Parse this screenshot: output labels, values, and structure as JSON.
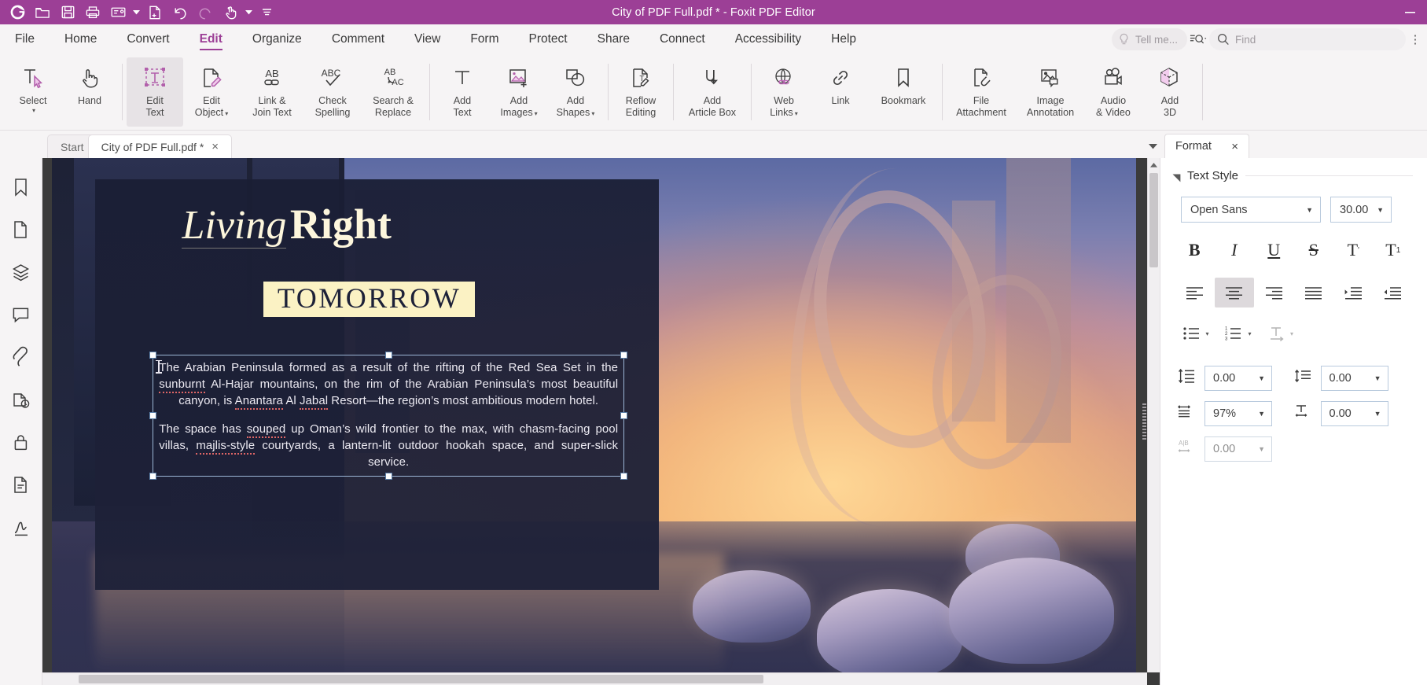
{
  "titlebar": {
    "title": "City of PDF Full.pdf * - Foxit PDF Editor",
    "quick_access": [
      {
        "name": "foxit-logo-icon",
        "label": "Foxit"
      },
      {
        "name": "open-folder-icon",
        "label": "Open"
      },
      {
        "name": "save-icon",
        "label": "Save"
      },
      {
        "name": "print-icon",
        "label": "Print"
      },
      {
        "name": "email-icon",
        "label": "Email"
      },
      {
        "name": "new-document-icon",
        "label": "Create"
      },
      {
        "name": "undo-icon",
        "label": "Undo"
      },
      {
        "name": "redo-icon",
        "label": "Redo"
      },
      {
        "name": "touch-mode-icon",
        "label": "Touch Mode"
      }
    ],
    "minimize_label": "Minimize"
  },
  "ribbon_tabs": [
    {
      "label": "File",
      "active": false
    },
    {
      "label": "Home",
      "active": false
    },
    {
      "label": "Convert",
      "active": false
    },
    {
      "label": "Edit",
      "active": true
    },
    {
      "label": "Organize",
      "active": false
    },
    {
      "label": "Comment",
      "active": false
    },
    {
      "label": "View",
      "active": false
    },
    {
      "label": "Form",
      "active": false
    },
    {
      "label": "Protect",
      "active": false
    },
    {
      "label": "Share",
      "active": false
    },
    {
      "label": "Connect",
      "active": false
    },
    {
      "label": "Accessibility",
      "active": false
    },
    {
      "label": "Help",
      "active": false
    }
  ],
  "tabbar_right": {
    "tell_me_placeholder": "Tell me...",
    "find_placeholder": "Find",
    "advanced_search_label": "Advanced Search",
    "more_label": "More"
  },
  "ribbon_groups": [
    {
      "items": [
        {
          "label_line1": "Select",
          "label_line2": "",
          "icon": "select-tool-icon",
          "caret": true,
          "active": false
        },
        {
          "label_line1": "Hand",
          "label_line2": "",
          "icon": "hand-tool-icon",
          "caret": false,
          "active": false
        }
      ]
    },
    {
      "items": [
        {
          "label_line1": "Edit",
          "label_line2": "Text",
          "icon": "edit-text-icon",
          "caret": false,
          "active": true
        },
        {
          "label_line1": "Edit",
          "label_line2": "Object",
          "icon": "edit-object-icon",
          "caret": true,
          "active": false
        },
        {
          "label_line1": "Link &",
          "label_line2": "Join Text",
          "icon": "link-join-text-icon",
          "caret": false,
          "active": false
        },
        {
          "label_line1": "Check",
          "label_line2": "Spelling",
          "icon": "check-spelling-icon",
          "caret": false,
          "active": false
        },
        {
          "label_line1": "Search &",
          "label_line2": "Replace",
          "icon": "search-replace-icon",
          "caret": false,
          "active": false
        }
      ]
    },
    {
      "items": [
        {
          "label_line1": "Add",
          "label_line2": "Text",
          "icon": "add-text-icon",
          "caret": false,
          "active": false
        },
        {
          "label_line1": "Add",
          "label_line2": "Images",
          "icon": "add-images-icon",
          "caret": true,
          "active": false
        },
        {
          "label_line1": "Add",
          "label_line2": "Shapes",
          "icon": "add-shapes-icon",
          "caret": true,
          "active": false
        }
      ]
    },
    {
      "items": [
        {
          "label_line1": "Reflow",
          "label_line2": "Editing",
          "icon": "reflow-editing-icon",
          "caret": false,
          "active": false
        }
      ]
    },
    {
      "items": [
        {
          "label_line1": "Add",
          "label_line2": "Article Box",
          "icon": "add-article-box-icon",
          "caret": false,
          "active": false
        }
      ]
    },
    {
      "items": [
        {
          "label_line1": "Web",
          "label_line2": "Links",
          "icon": "web-links-icon",
          "caret": true,
          "active": false
        },
        {
          "label_line1": "Link",
          "label_line2": "",
          "icon": "link-icon",
          "caret": false,
          "active": false
        },
        {
          "label_line1": "Bookmark",
          "label_line2": "",
          "icon": "bookmark-icon",
          "caret": false,
          "active": false
        }
      ]
    },
    {
      "items": [
        {
          "label_line1": "File",
          "label_line2": "Attachment",
          "icon": "file-attachment-icon",
          "caret": false,
          "active": false
        },
        {
          "label_line1": "Image",
          "label_line2": "Annotation",
          "icon": "image-annotation-icon",
          "caret": false,
          "active": false
        },
        {
          "label_line1": "Audio",
          "label_line2": "& Video",
          "icon": "audio-video-icon",
          "caret": false,
          "active": false
        },
        {
          "label_line1": "Add",
          "label_line2": "3D",
          "icon": "add-3d-icon",
          "caret": false,
          "active": false
        }
      ]
    }
  ],
  "doc_tabs": [
    {
      "label": "Start",
      "closable": false,
      "selected": false
    },
    {
      "label": "City of PDF Full.pdf *",
      "closable": true,
      "selected": true
    }
  ],
  "doc_tabs_close_glyph": "×",
  "panel_tab": {
    "label": "Format",
    "close_glyph": "×"
  },
  "left_rail": [
    {
      "name": "bookmarks-icon",
      "label": "Bookmarks"
    },
    {
      "name": "page-thumbnails-icon",
      "label": "Page Thumbnails"
    },
    {
      "name": "layers-icon",
      "label": "Layers"
    },
    {
      "name": "comments-icon",
      "label": "Comments"
    },
    {
      "name": "attachments-icon",
      "label": "Attachments"
    },
    {
      "name": "stamps-icon",
      "label": "Stamps"
    },
    {
      "name": "security-icon",
      "label": "Security"
    },
    {
      "name": "destinations-icon",
      "label": "Destinations"
    },
    {
      "name": "signatures-icon",
      "label": "Digital Signatures"
    }
  ],
  "document": {
    "headline_italic": "Living",
    "headline_bold": "Right",
    "subheadline": "TOMORROW",
    "paragraph1_parts": [
      {
        "t": "The Arabian Peninsula formed as a result of the rifting of the Red Sea Set in the ",
        "spell": false
      },
      {
        "t": "sunburnt",
        "spell": true
      },
      {
        "t": " Al-Hajar mountains, on the rim of the Arabian Peninsula’s most beautiful canyon, is ",
        "spell": false
      },
      {
        "t": "Anantara",
        "spell": true
      },
      {
        "t": " Al ",
        "spell": false
      },
      {
        "t": "Jabal",
        "spell": true
      },
      {
        "t": " Resort—the region’s most ambitious modern hotel.",
        "spell": false
      }
    ],
    "paragraph2_parts": [
      {
        "t": "The space has ",
        "spell": false
      },
      {
        "t": "souped",
        "spell": true
      },
      {
        "t": " up Oman’s wild frontier to the max, with chasm-facing pool villas, ",
        "spell": false
      },
      {
        "t": "majlis-style",
        "spell": true
      },
      {
        "t": " courtyards, a lantern-lit outdoor hookah space, and super-slick service.",
        "spell": false
      }
    ]
  },
  "format_panel": {
    "section_title": "Text Style",
    "font_family_value": "Open Sans",
    "font_size_value": "30.00",
    "style_buttons": [
      {
        "name": "bold-button",
        "glyph": "B",
        "active": false
      },
      {
        "name": "italic-button",
        "glyph": "I",
        "active": false
      },
      {
        "name": "underline-button",
        "glyph": "U",
        "active": false
      },
      {
        "name": "strikethrough-button",
        "glyph": "S",
        "active": false
      },
      {
        "name": "superscript-button",
        "glyph": "T",
        "active": false
      },
      {
        "name": "subscript-button",
        "glyph": "T",
        "active": false
      }
    ],
    "align_buttons": [
      {
        "name": "align-left-button",
        "active": false
      },
      {
        "name": "align-center-button",
        "active": true
      },
      {
        "name": "align-right-button",
        "active": false
      },
      {
        "name": "align-justify-button",
        "active": false
      },
      {
        "name": "increase-indent-button",
        "active": false
      },
      {
        "name": "decrease-indent-button",
        "active": false
      }
    ],
    "list_buttons": [
      {
        "name": "bulleted-list-button"
      },
      {
        "name": "numbered-list-button"
      },
      {
        "name": "text-direction-button"
      }
    ],
    "spacing_fields": [
      {
        "name": "line-spacing-field",
        "icon": "line-spacing-icon",
        "value": "0.00",
        "dim": false
      },
      {
        "name": "paragraph-spacing-field",
        "icon": "paragraph-spacing-icon",
        "value": "0.00",
        "dim": false
      },
      {
        "name": "horizontal-scale-field",
        "icon": "horizontal-scale-icon",
        "value": "97%",
        "dim": false
      },
      {
        "name": "character-width-field",
        "icon": "character-width-icon",
        "value": "0.00",
        "dim": false
      },
      {
        "name": "character-spacing-field",
        "icon": "character-spacing-icon",
        "value": "0.00",
        "dim": true
      }
    ]
  },
  "colors": {
    "brand_purple": "#9c3f96",
    "ribbon_bg": "#f6f4f5",
    "accent_pink": "#e8a9e0",
    "selection_blue": "#5b7fa8"
  }
}
